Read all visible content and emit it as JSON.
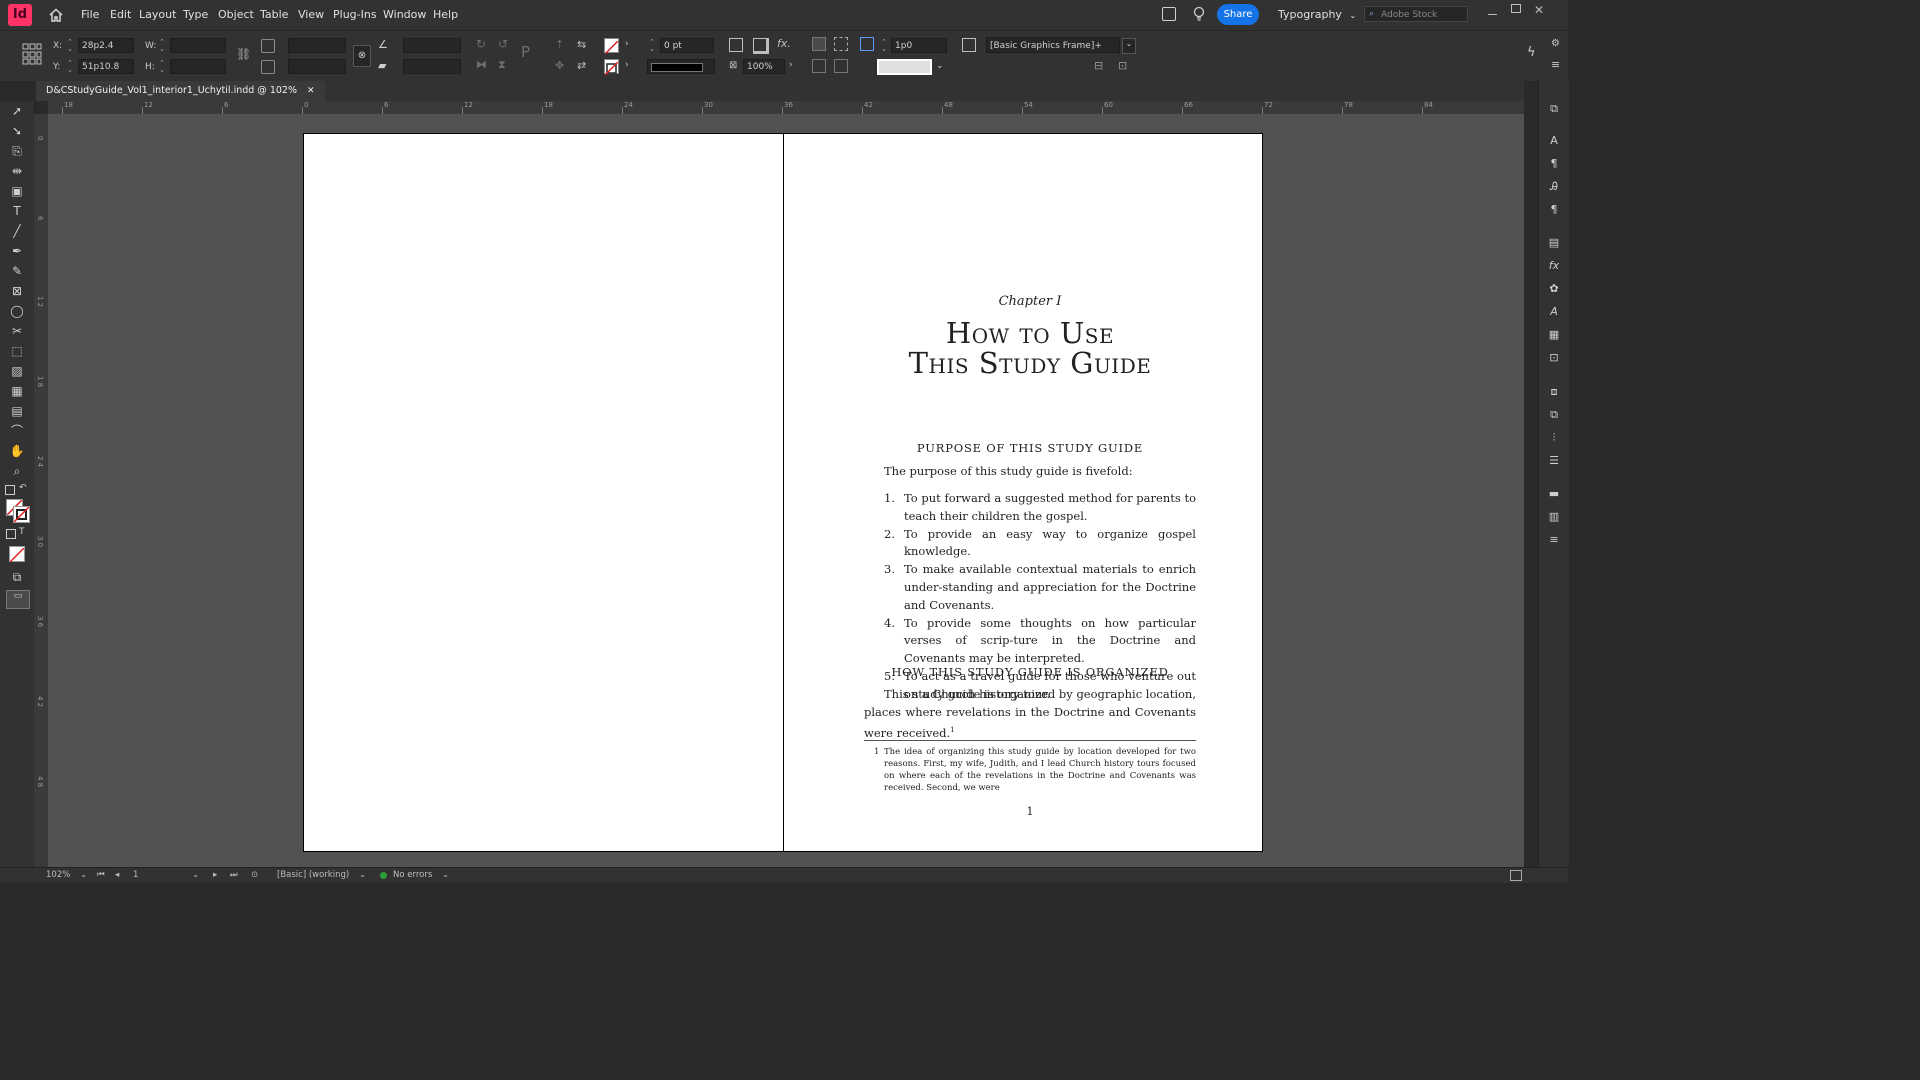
{
  "app": {
    "icon_label": "Id",
    "menus": [
      "File",
      "Edit",
      "Layout",
      "Type",
      "Object",
      "Table",
      "View",
      "Plug-Ins",
      "Window",
      "Help"
    ],
    "share_label": "Share",
    "workspace": "Typography",
    "search_placeholder": "Adobe Stock"
  },
  "control": {
    "x_label": "X:",
    "x_value": "28p2.4",
    "y_label": "Y:",
    "y_value": "51p10.8",
    "w_label": "W:",
    "h_label": "H:",
    "stroke_weight": "0 pt",
    "scale_percent": "100%",
    "offset_value": "1p0",
    "object_style": "[Basic Graphics Frame]+"
  },
  "tab": {
    "title": "D&CStudyGuide_Vol1_interior1_Uchytil.indd @ 102%"
  },
  "ruler": {
    "h_marks": [
      "18",
      "12",
      "6",
      "0",
      "6",
      "12",
      "18",
      "24",
      "30",
      "36",
      "42",
      "48",
      "54",
      "60",
      "66",
      "72",
      "78",
      "84"
    ],
    "v_marks": [
      "0",
      "6",
      "1 2",
      "1 8",
      "2 4",
      "3 0",
      "3 6",
      "4 2",
      "4 8"
    ]
  },
  "document": {
    "chapter_label": "Chapter I",
    "chapter_title_line1": "How to Use",
    "chapter_title_line2": "This Study Guide",
    "purpose_heading": "PURPOSE OF THIS STUDY GUIDE",
    "purpose_intro": "The purpose of this study guide is fivefold:",
    "list": [
      {
        "num": "1.",
        "text": "To put forward a suggested method for parents to teach their children the gospel."
      },
      {
        "num": "2.",
        "text": "To provide an easy way to organize gospel knowledge."
      },
      {
        "num": "3.",
        "text": "To make available contextual materials to enrich under-standing and appreciation for the Doctrine and Covenants."
      },
      {
        "num": "4.",
        "text": "To provide some thoughts on how particular verses of scrip-ture in the Doctrine and Covenants may be interpreted."
      },
      {
        "num": "5.",
        "text": "To act as a travel guide for those who venture out on a Church history tour."
      }
    ],
    "organized_heading": "HOW THIS STUDY GUIDE IS ORGANIZED",
    "organized_text": "This study guide is organized by geographic location, places where revelations in the Doctrine and Covenants were received.",
    "organized_footnote_ref": "1",
    "footnote_num": "1",
    "footnote_text": "The idea of organizing this study guide by location developed for two reasons. First, my wife, Judith, and I lead Church history tours focused on where each of the revelations in the Doctrine and Covenants was received. Second, we were",
    "page_number": "1"
  },
  "status": {
    "zoom": "102%",
    "page": "1",
    "preflight_profile": "[Basic] (working)",
    "errors": "No errors"
  },
  "colors": {
    "brand": "#ff3366",
    "share": "#1473e6",
    "status_ok": "#2d9d3a"
  }
}
